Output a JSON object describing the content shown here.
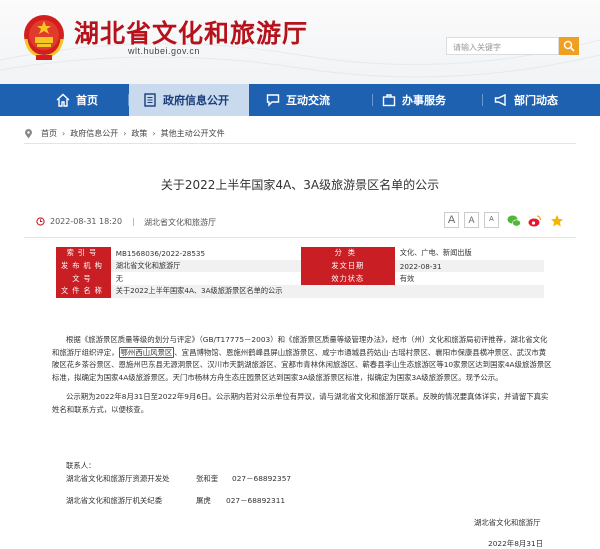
{
  "header": {
    "title": "湖北省文化和旅游厅",
    "url": "wlt.hubei.gov.cn",
    "search_placeholder": "请输入关键字"
  },
  "nav": {
    "items": [
      {
        "label": "首页",
        "icon": "home-icon"
      },
      {
        "label": "政府信息公开",
        "icon": "document-icon"
      },
      {
        "label": "互动交流",
        "icon": "chat-icon"
      },
      {
        "label": "办事服务",
        "icon": "briefcase-icon"
      },
      {
        "label": "部门动态",
        "icon": "megaphone-icon"
      }
    ],
    "active_index": 1
  },
  "breadcrumb": [
    "首页",
    "政府信息公开",
    "政策",
    "其他主动公开文件"
  ],
  "article": {
    "title": "关于2022上半年国家4A、3A级旅游景区名单的公示",
    "datetime": "2022-08-31 18:20",
    "source": "湖北省文化和旅游厅",
    "font_sizes": [
      "A",
      "A",
      "A"
    ]
  },
  "info_table": {
    "rows": [
      {
        "k1": "索引号",
        "v1": "MB1568036/2022-28535",
        "k2": "分类",
        "v2": "文化、广电、新闻出版"
      },
      {
        "k1": "发布机构",
        "v1": "湖北省文化和旅游厅",
        "k2": "发文日期",
        "v2": "2022-08-31"
      },
      {
        "k1": "文号",
        "v1": "无",
        "k2": "效力状态",
        "v2": "有效"
      },
      {
        "k1": "文件名称",
        "v1": "关于2022上半年国家4A、3A级旅游景区名单的公示",
        "k2": "",
        "v2": ""
      }
    ]
  },
  "body": {
    "p1_a": "根据《旅游景区质量等级的划分与评定》（GB/T17775－2003）和《旅游景区质量等级管理办法》，经市（州）文化和旅游局初评推荐，湖北省文化和旅游厅组织评定，",
    "p1_highlight": "鄂州西山风景区",
    "p1_b": "、宜昌博物馆、恩施州鹤峰县屏山旅游景区、咸宁市通城县药姑山·古瑶村景区、襄阳市保康县横冲景区、武汉市黄陂区花乡茶谷景区、恩施州巴东县无源洞景区、汉川市天鹅湖旅游区、宜都市青林休闲旅游区、蕲春县李山生态旅游区等10家景区达到国家4A级旅游景区标准，拟确定为国家4A级旅游景区。天门市杨林方舟生态庄园景区达到国家3A级旅游景区标准，拟确定为国家3A级旅游景区。现予公示。",
    "p2": "公示期为2022年8月31日至2022年9月6日。公示期内若对公示单位有异议，请与湖北省文化和旅游厅联系。反映的情况要真体详实，并请留下真实姓名和联系方式，以便核查。",
    "contact_label": "联系人：",
    "contacts": [
      {
        "dept": "湖北省文化和旅游厅资源开发处",
        "name": "张和奎",
        "phone": "027－68892357"
      },
      {
        "dept": "湖北省文化和旅游厅机关纪委",
        "name": "屠虎",
        "phone": "027－68892311"
      }
    ],
    "signature": "湖北省文化和旅游厅",
    "date": "2022年8月31日"
  }
}
